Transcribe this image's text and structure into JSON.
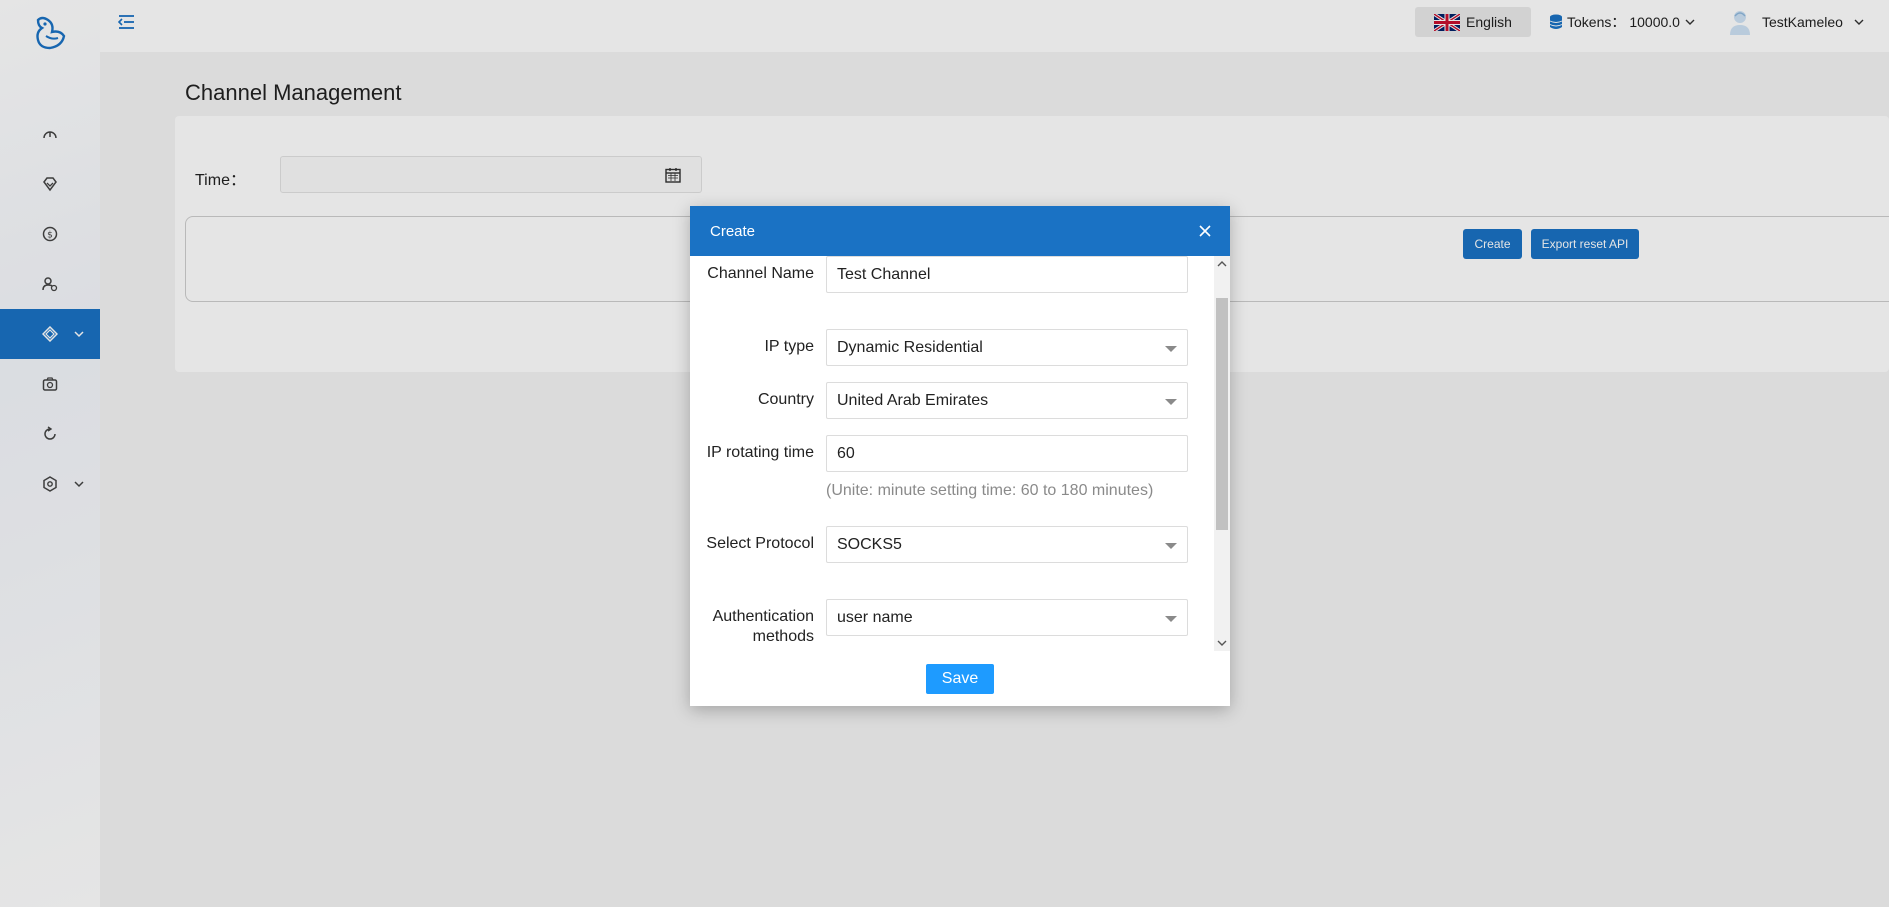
{
  "header": {
    "language": "English",
    "tokens_label": "Tokens：",
    "tokens_value": "10000.0",
    "username": "TestKameleo"
  },
  "sidebar": {
    "items": [
      {
        "icon": "dashboard-icon"
      },
      {
        "icon": "diamond-icon"
      },
      {
        "icon": "dollar-icon"
      },
      {
        "icon": "user-settings-icon"
      },
      {
        "icon": "channel-icon",
        "active": true
      },
      {
        "icon": "camera-icon"
      },
      {
        "icon": "refresh-icon"
      },
      {
        "icon": "settings-icon"
      }
    ]
  },
  "page": {
    "title": "Channel Management",
    "time_label": "Time：",
    "create_button": "Create",
    "export_button": "Export reset API"
  },
  "modal": {
    "title": "Create",
    "fields": {
      "channel_name_label": "Channel Name",
      "channel_name_value": "Test Channel",
      "ip_type_label": "IP type",
      "ip_type_value": "Dynamic Residential",
      "country_label": "Country",
      "country_value": "United Arab Emirates",
      "ip_rotating_label": "IP rotating time",
      "ip_rotating_value": "60",
      "ip_rotating_hint": "(Unite: minute setting time: 60 to 180 minutes)",
      "protocol_label": "Select Protocol",
      "protocol_value": "SOCKS5",
      "auth_label": "Authentication methods",
      "auth_value": "user name"
    },
    "save_button": "Save"
  },
  "colors": {
    "primary": "#1a72c4",
    "save": "#1e9bff"
  }
}
